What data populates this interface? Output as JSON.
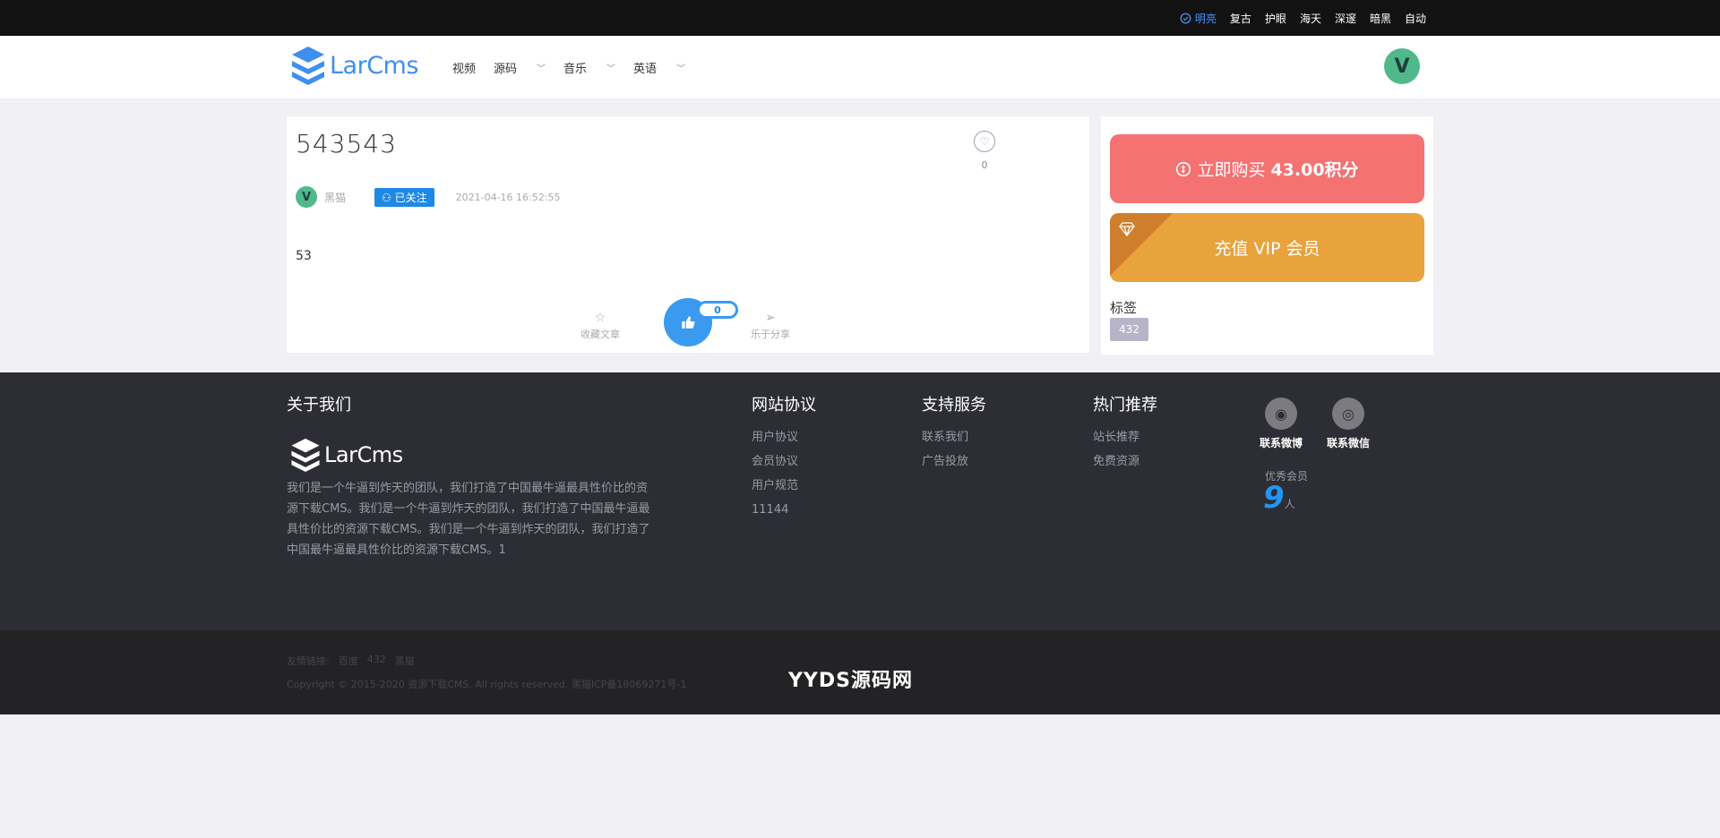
{
  "theme_bar": {
    "items": [
      {
        "label": "明亮",
        "active": true
      },
      {
        "label": "复古",
        "active": false
      },
      {
        "label": "护眼",
        "active": false
      },
      {
        "label": "海天",
        "active": false
      },
      {
        "label": "深邃",
        "active": false
      },
      {
        "label": "暗黑",
        "active": false
      },
      {
        "label": "自动",
        "active": false
      }
    ]
  },
  "header": {
    "logo_text": "LarCms",
    "nav": [
      {
        "label": "视频",
        "has_dropdown": false
      },
      {
        "label": "源码",
        "has_dropdown": true
      },
      {
        "label": "音乐",
        "has_dropdown": true
      },
      {
        "label": "英语",
        "has_dropdown": true
      }
    ],
    "avatar_letter": "V"
  },
  "article": {
    "title": "543543",
    "like_count": "0",
    "author_avatar_letter": "V",
    "author_name": "黑猫",
    "follow_label": "已关注",
    "date": "2021-04-16 16:52:55",
    "body": "53",
    "collect_label": "收藏文章",
    "share_label": "乐于分享",
    "thumb_count": "0"
  },
  "sidebar": {
    "buy_label": "立即购买",
    "buy_price": "43.00积分",
    "vip_label": "充值 VIP 会员",
    "tags_title": "标签",
    "tags": [
      "432"
    ]
  },
  "footer": {
    "about_title": "关于我们",
    "logo_text": "LarCms",
    "about_desc": "我们是一个牛逼到炸天的团队，我们打造了中国最牛逼最具性价比的资源下载CMS。我们是一个牛逼到炸天的团队，我们打造了中国最牛逼最具性价比的资源下载CMS。我们是一个牛逼到炸天的团队，我们打造了中国最牛逼最具性价比的资源下载CMS。1",
    "columns": [
      {
        "title": "网站协议",
        "links": [
          "用户协议",
          "会员协议",
          "用户规范",
          "11144"
        ]
      },
      {
        "title": "支持服务",
        "links": [
          "联系我们",
          "广告投放"
        ]
      },
      {
        "title": "热门推荐",
        "links": [
          "站长推荐",
          "免费资源"
        ]
      }
    ],
    "weibo_label": "联系微博",
    "wechat_label": "联系微信",
    "member_label": "优秀会员",
    "member_count": "9",
    "member_unit": "人",
    "friend_links_prefix": "友情链接:",
    "friend_links": [
      "百度",
      "432",
      "黑猫"
    ],
    "copyright": "Copyright © 2015-2020 资源下载CMS. All rights reserved. 黑猫ICP备18069271号-1",
    "brand": "YYDS源码网"
  },
  "colors": {
    "accent_blue": "#1e88e5",
    "buy_red": "#f47272",
    "vip_orange": "#e8a33d",
    "footer_bg": "#2d2e35"
  }
}
